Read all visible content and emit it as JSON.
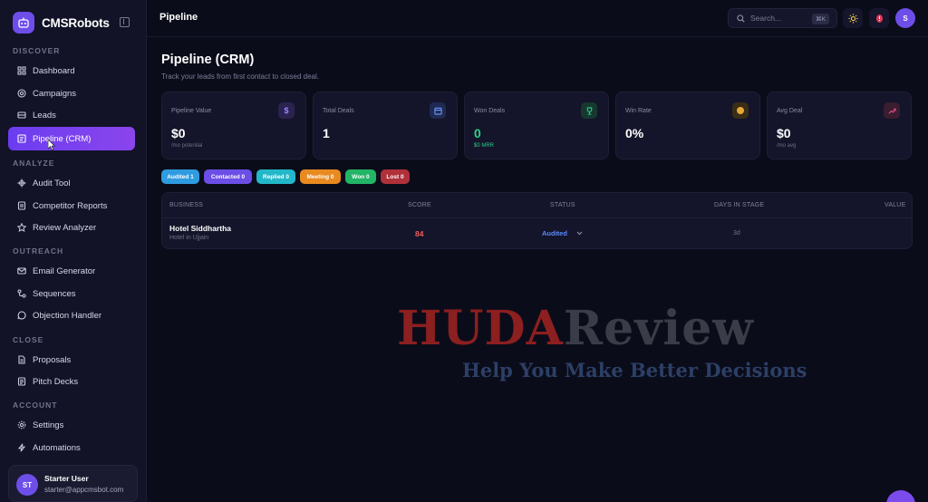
{
  "brand": {
    "name": "CMSRobots"
  },
  "sidebar": {
    "sections": [
      {
        "label": "DISCOVER"
      },
      {
        "label": "ANALYZE"
      },
      {
        "label": "OUTREACH"
      },
      {
        "label": "CLOSE"
      },
      {
        "label": "ACCOUNT"
      }
    ],
    "items": [
      {
        "label": "Dashboard",
        "icon": "grid-icon"
      },
      {
        "label": "Campaigns",
        "icon": "target-icon"
      },
      {
        "label": "Leads",
        "icon": "layers-icon"
      },
      {
        "label": "Pipeline (CRM)",
        "icon": "board-icon",
        "active": true
      },
      {
        "label": "Audit Tool",
        "icon": "crosshair-icon"
      },
      {
        "label": "Competitor Reports",
        "icon": "doc-icon"
      },
      {
        "label": "Review Analyzer",
        "icon": "star-icon"
      },
      {
        "label": "Email Generator",
        "icon": "mail-icon"
      },
      {
        "label": "Sequences",
        "icon": "nodes-icon"
      },
      {
        "label": "Objection Handler",
        "icon": "chat-icon"
      },
      {
        "label": "Proposals",
        "icon": "file-icon"
      },
      {
        "label": "Pitch Decks",
        "icon": "slides-icon"
      },
      {
        "label": "Settings",
        "icon": "gear-icon"
      },
      {
        "label": "Automations",
        "icon": "bolt-icon"
      }
    ]
  },
  "user": {
    "initials": "ST",
    "name": "Starter User",
    "email": "starter@appcmsbot.com"
  },
  "topbar": {
    "title": "Pipeline",
    "search_placeholder": "Search...",
    "search_shortcut": "⌘K",
    "avatar_initial": "S"
  },
  "page": {
    "title": "Pipeline (CRM)",
    "subtitle": "Track your leads from first contact to closed deal."
  },
  "stats": [
    {
      "label": "Pipeline Value",
      "value": "$0",
      "sub": "/mo potential",
      "icon": "dollar-icon",
      "color": "#7a5cff"
    },
    {
      "label": "Total Deals",
      "value": "1",
      "sub": "",
      "icon": "calendar-icon",
      "color": "#5b8cff"
    },
    {
      "label": "Won Deals",
      "value": "0",
      "sub": "$0 MRR",
      "icon": "trophy-icon",
      "color": "#2ecf8a"
    },
    {
      "label": "Win Rate",
      "value": "0%",
      "sub": "",
      "icon": "circle-icon",
      "color": "#e8a83a"
    },
    {
      "label": "Avg Deal",
      "value": "$0",
      "sub": "/mo avg",
      "icon": "trend-icon",
      "color": "#e0508a"
    }
  ],
  "status_pills": [
    {
      "label": "Audited 1",
      "color": "#2f9be0"
    },
    {
      "label": "Contacted 0",
      "color": "#6b4ee6"
    },
    {
      "label": "Replied 0",
      "color": "#22b8c9"
    },
    {
      "label": "Meeting 0",
      "color": "#e88a1f"
    },
    {
      "label": "Won 0",
      "color": "#22b566"
    },
    {
      "label": "Lost 0",
      "color": "#b0303a"
    }
  ],
  "table": {
    "headers": [
      "BUSINESS",
      "SCORE",
      "STATUS",
      "DAYS IN STAGE",
      "VALUE"
    ],
    "rows": [
      {
        "business": "Hotel Siddhartha",
        "location": "Hotel in Ujjain",
        "score": "84",
        "status": "Audited",
        "days": "3d",
        "value": ""
      }
    ]
  },
  "watermark": {
    "title_a": "HUDA",
    "title_b": "Review",
    "tagline": "Help You Make Better Decisions"
  }
}
